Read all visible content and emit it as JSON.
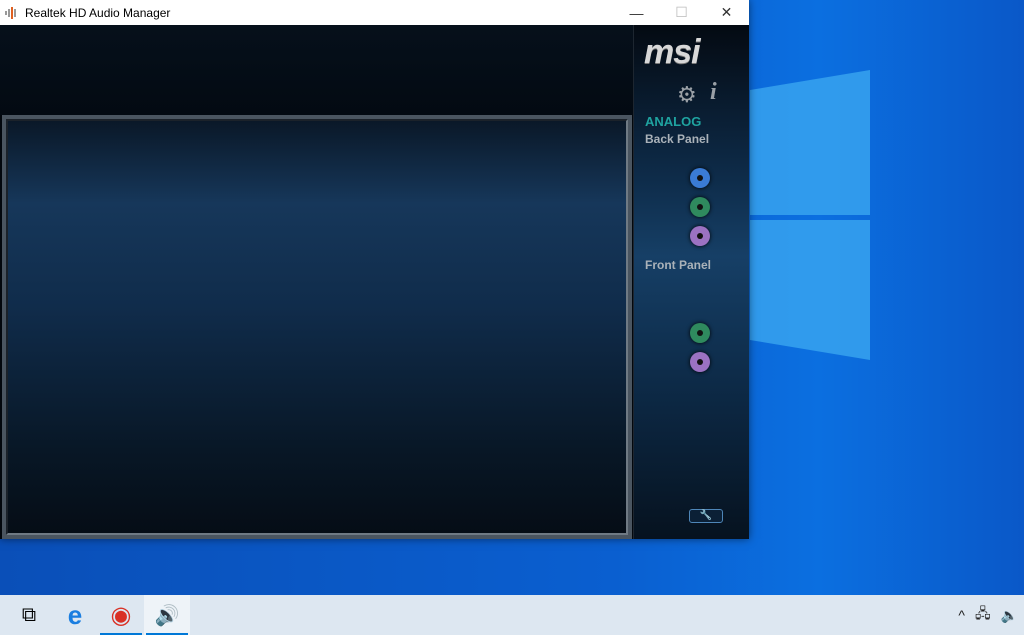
{
  "window": {
    "title": "Realtek HD Audio Manager",
    "minimize": "—",
    "maximize": "☐",
    "close": "✕"
  },
  "sidebar": {
    "brand": "msi",
    "settings_icon": "⚙",
    "info_icon": "i",
    "section": "ANALOG",
    "back_panel": "Back Panel",
    "front_panel": "Front Panel",
    "wrench_icon": "🔧",
    "back_jacks": [
      {
        "name": "line-in",
        "color": "#3a7bd5"
      },
      {
        "name": "line-out",
        "color": "#2f8a5e"
      },
      {
        "name": "mic-in",
        "color": "#9b72c2"
      }
    ],
    "front_jacks": [
      {
        "name": "headphone",
        "color": "#2f8a5e"
      },
      {
        "name": "mic",
        "color": "#9b72c2"
      }
    ]
  },
  "taskbar": {
    "task_view": "⧉",
    "edge": "e",
    "chrome": "◉",
    "realtek": "🔊",
    "tray_chevron": "^",
    "network": "🖧",
    "volume": "🔈"
  }
}
